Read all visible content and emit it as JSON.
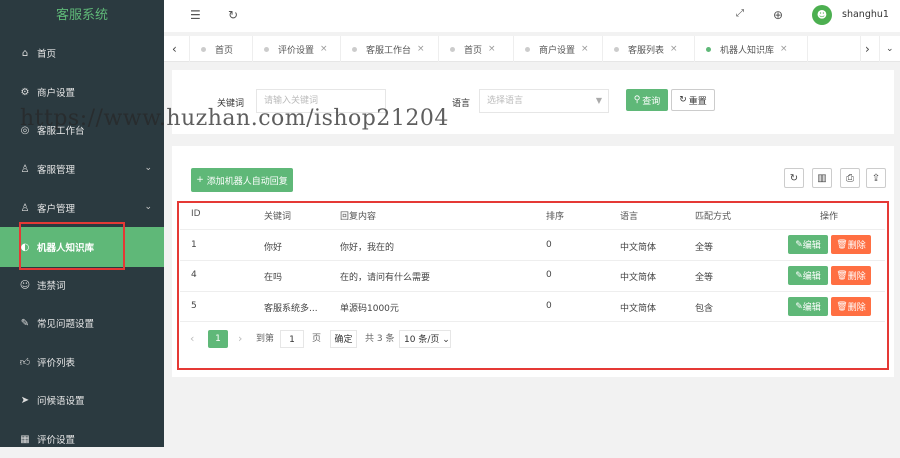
{
  "app": {
    "title": "客服系统"
  },
  "sidebar": {
    "items": [
      {
        "label": "首页",
        "icon": "home-icon"
      },
      {
        "label": "商户设置",
        "icon": "gear-icon"
      },
      {
        "label": "客服工作台",
        "icon": "headset-icon"
      },
      {
        "label": "客服管理",
        "icon": "user-icon"
      },
      {
        "label": "客户管理",
        "icon": "user-icon"
      },
      {
        "label": "机器人知识库",
        "icon": "robot-icon"
      },
      {
        "label": "违禁词",
        "icon": "smile-icon"
      },
      {
        "label": "常见问题设置",
        "icon": "edit-icon"
      },
      {
        "label": "评价列表",
        "icon": "thumb-icon"
      },
      {
        "label": "问候语设置",
        "icon": "send-icon"
      },
      {
        "label": "评价设置",
        "icon": "calendar-icon"
      }
    ]
  },
  "header": {
    "username": "shanghu1"
  },
  "tabs": [
    {
      "label": "首页"
    },
    {
      "label": "评价设置"
    },
    {
      "label": "客服工作台"
    },
    {
      "label": "首页"
    },
    {
      "label": "商户设置"
    },
    {
      "label": "客服列表"
    },
    {
      "label": "机器人知识库"
    }
  ],
  "search": {
    "keyword_label": "关键词",
    "keyword_placeholder": "请输入关键词",
    "lang_label": "语言",
    "lang_placeholder": "选择语言",
    "query_button": "查询",
    "reset_button": "重置"
  },
  "table": {
    "add_button": "添加机器人自动回复",
    "columns": [
      "ID",
      "关键词",
      "回复内容",
      "排序",
      "语言",
      "匹配方式",
      "操作"
    ],
    "rows": [
      {
        "id": "1",
        "keyword": "你好",
        "reply": "你好，我在的",
        "sort": "0",
        "lang": "中文简体",
        "match": "全等"
      },
      {
        "id": "4",
        "keyword": "在吗",
        "reply": "在的，请问有什么需要",
        "sort": "0",
        "lang": "中文简体",
        "match": "全等"
      },
      {
        "id": "5",
        "keyword": "客服系统多...",
        "reply": "单源码1000元",
        "sort": "0",
        "lang": "中文简体",
        "match": "包含"
      }
    ],
    "edit_label": "编辑",
    "delete_label": "删除"
  },
  "pagination": {
    "current": "1",
    "goto_label": "到第",
    "page_input": "1",
    "page_unit": "页",
    "confirm": "确定",
    "total": "共 3 条",
    "page_size": "10 条/页"
  },
  "watermark": "https://www.huzhan.com/ishop21204",
  "colors": {
    "accent": "#5fb878",
    "sidebar": "#2b3a40",
    "danger": "#ff5722",
    "highlight_box": "#e53935"
  }
}
